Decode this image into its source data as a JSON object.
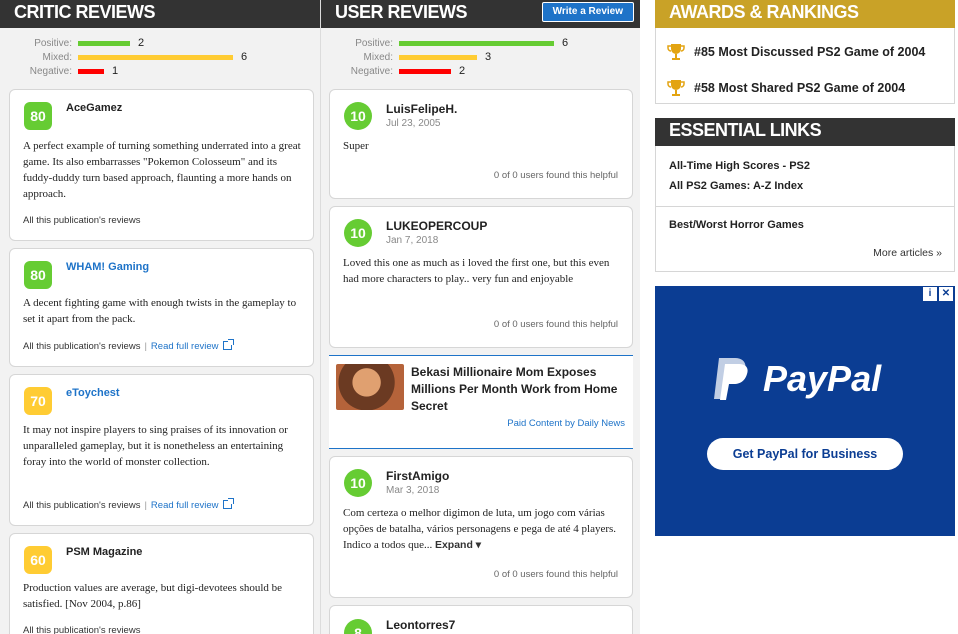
{
  "critic": {
    "title": "CRITIC REVIEWS",
    "distribution": [
      {
        "label": "Positive:",
        "count": "2",
        "color": "#66cc33"
      },
      {
        "label": "Mixed:",
        "count": "6",
        "color": "#ffcc33"
      },
      {
        "label": "Negative:",
        "count": "1",
        "color": "#ff0000"
      }
    ],
    "reviews": [
      {
        "score": "80",
        "publication": "AceGamez",
        "text": "A perfect example of turning something underrated into a great game. Its also embarrasses \"Pokemon Colosseum\" and its fuddy-duddy turn based approach, flaunting a more hands on approach.",
        "footer": "All this publication's reviews"
      },
      {
        "score": "80",
        "publication": "WHAM! Gaming",
        "text": "A decent fighting game with enough twists in the gameplay to set it apart from the pack.",
        "footer": "All this publication's reviews",
        "read_full": "Read full review"
      },
      {
        "score": "70",
        "publication": "eToychest",
        "text": "It may not inspire players to sing praises of its innovation or unparalleled gameplay, but it is nonetheless an entertaining foray into the world of monster collection.",
        "footer": "All this publication's reviews",
        "read_full": "Read full review"
      },
      {
        "score": "60",
        "publication": "PSM Magazine",
        "text": "Production values are average, but digi-devotees should be satisfied. [Nov 2004, p.86]",
        "footer": "All this publication's reviews"
      }
    ]
  },
  "user": {
    "title": "USER REVIEWS",
    "write_review": "Write a Review",
    "distribution": [
      {
        "label": "Positive:",
        "count": "6",
        "color": "#66cc33"
      },
      {
        "label": "Mixed:",
        "count": "3",
        "color": "#ffcc33"
      },
      {
        "label": "Negative:",
        "count": "2",
        "color": "#ff0000"
      }
    ],
    "reviews": [
      {
        "score": "10",
        "name": "LuisFelipeH.",
        "date": "Jul 23, 2005",
        "text": "Super",
        "helpful": "0 of 0 users found this helpful"
      },
      {
        "score": "10",
        "name": "LUKEOPERCOUP",
        "date": "Jan 7, 2018",
        "text": "Loved this one as much as i loved the first one, but this even had more characters to play.. very fun and enjoyable",
        "helpful": "0 of 0 users found this helpful"
      },
      {
        "score": "10",
        "name": "FirstAmigo",
        "date": "Mar 3, 2018",
        "text": "Com certeza o melhor digimon de luta, um jogo com várias opções de batalha, vários personagens e pega de até 4 players. Indico a todos que...",
        "expand": "Expand ▾",
        "helpful": "0 of 0 users found this helpful"
      },
      {
        "score": "8",
        "name": "Leontorres7"
      }
    ],
    "ad": {
      "title": "Bekasi Millionaire Mom Exposes Millions Per Month Work from Home Secret",
      "source": "Paid Content by Daily News"
    }
  },
  "awards": {
    "title": "AWARDS & RANKINGS",
    "items": [
      "#85 Most Discussed PS2 Game of 2004",
      "#58 Most Shared PS2 Game of 2004"
    ]
  },
  "links": {
    "title": "ESSENTIAL LINKS",
    "items": [
      "All-Time High Scores - PS2",
      "All PS2 Games: A-Z Index",
      "Best/Worst Horror Games"
    ],
    "more": "More articles »"
  },
  "paypal_ad": {
    "brand": "PayPal",
    "button": "Get PayPal for Business"
  }
}
